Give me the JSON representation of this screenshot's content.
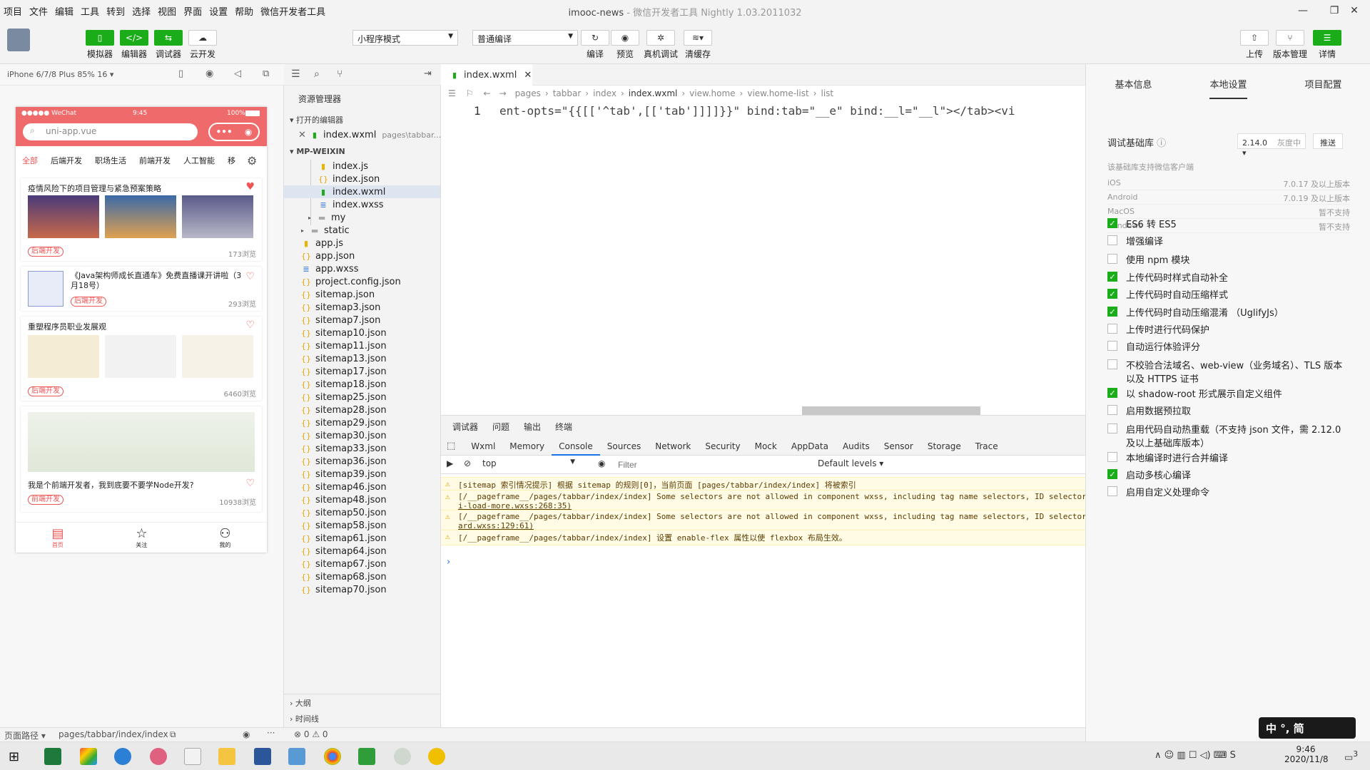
{
  "menubar": {
    "items": [
      "项目",
      "文件",
      "编辑",
      "工具",
      "转到",
      "选择",
      "视图",
      "界面",
      "设置",
      "帮助",
      "微信开发者工具"
    ],
    "title": "imooc-news",
    "title_sub": "- 微信开发者工具 Nightly 1.03.2011032"
  },
  "toolbar": {
    "simulator": "模拟器",
    "editor": "编辑器",
    "debugger": "调试器",
    "cloud": "云开发",
    "mode_select": "小程序模式",
    "compile_select": "普通编译",
    "compile": "编译",
    "preview": "预览",
    "realdebug": "真机调试",
    "clearcache": "清缓存",
    "upload": "上传",
    "version": "版本管理",
    "details": "详情"
  },
  "simulator": {
    "device": "iPhone 6/7/8 Plus 85% 16",
    "statusbar": {
      "carrier": "●●●●● WeChat",
      "time": "9:45",
      "battery": "100%"
    },
    "search_placeholder": "uni-app.vue",
    "tabs": [
      "全部",
      "后端开发",
      "职场生活",
      "前端开发",
      "人工智能",
      "移"
    ],
    "cards": [
      {
        "title": "疫情风险下的项目管理与紧急预案策略",
        "tag": "后端开发",
        "views": "173浏览"
      },
      {
        "title": "《Java架构师成长直通车》免费直播课开讲啦（3月18号）",
        "tag": "后端开发",
        "views": "293浏览"
      },
      {
        "title": "重塑程序员职业发展观",
        "tag": "后端开发",
        "views": "6460浏览"
      },
      {
        "title": "我是个前端开发者，我到底要不要学Node开发?",
        "tag": "前端开发",
        "views": "10938浏览"
      }
    ],
    "bottom_nav": [
      "首页",
      "关注",
      "我的"
    ],
    "path_label": "页面路径",
    "path": "pages/tabbar/index/index"
  },
  "explorer": {
    "title": "资源管理器",
    "open_editors": "打开的编辑器",
    "open_file": "index.wxml",
    "open_file_path": "pages\\tabbar...",
    "project": "MP-WEIXIN",
    "files": [
      {
        "name": "index.js",
        "type": "js",
        "indent": 3
      },
      {
        "name": "index.json",
        "type": "json",
        "indent": 3
      },
      {
        "name": "index.wxml",
        "type": "wxml",
        "indent": 3
      },
      {
        "name": "index.wxss",
        "type": "wxss",
        "indent": 3
      },
      {
        "name": "my",
        "type": "folder",
        "indent": 2
      },
      {
        "name": "static",
        "type": "folder",
        "indent": 1
      },
      {
        "name": "app.js",
        "type": "js",
        "indent": 1
      },
      {
        "name": "app.json",
        "type": "json",
        "indent": 1
      },
      {
        "name": "app.wxss",
        "type": "wxss",
        "indent": 1
      },
      {
        "name": "project.config.json",
        "type": "json",
        "indent": 1
      },
      {
        "name": "sitemap.json",
        "type": "json",
        "indent": 1
      },
      {
        "name": "sitemap3.json",
        "type": "json",
        "indent": 1
      },
      {
        "name": "sitemap7.json",
        "type": "json",
        "indent": 1
      },
      {
        "name": "sitemap10.json",
        "type": "json",
        "indent": 1
      },
      {
        "name": "sitemap11.json",
        "type": "json",
        "indent": 1
      },
      {
        "name": "sitemap13.json",
        "type": "json",
        "indent": 1
      },
      {
        "name": "sitemap17.json",
        "type": "json",
        "indent": 1
      },
      {
        "name": "sitemap18.json",
        "type": "json",
        "indent": 1
      },
      {
        "name": "sitemap25.json",
        "type": "json",
        "indent": 1
      },
      {
        "name": "sitemap28.json",
        "type": "json",
        "indent": 1
      },
      {
        "name": "sitemap29.json",
        "type": "json",
        "indent": 1
      },
      {
        "name": "sitemap30.json",
        "type": "json",
        "indent": 1
      },
      {
        "name": "sitemap33.json",
        "type": "json",
        "indent": 1
      },
      {
        "name": "sitemap36.json",
        "type": "json",
        "indent": 1
      },
      {
        "name": "sitemap39.json",
        "type": "json",
        "indent": 1
      },
      {
        "name": "sitemap46.json",
        "type": "json",
        "indent": 1
      },
      {
        "name": "sitemap48.json",
        "type": "json",
        "indent": 1
      },
      {
        "name": "sitemap50.json",
        "type": "json",
        "indent": 1
      },
      {
        "name": "sitemap58.json",
        "type": "json",
        "indent": 1
      },
      {
        "name": "sitemap61.json",
        "type": "json",
        "indent": 1
      },
      {
        "name": "sitemap64.json",
        "type": "json",
        "indent": 1
      },
      {
        "name": "sitemap67.json",
        "type": "json",
        "indent": 1
      },
      {
        "name": "sitemap68.json",
        "type": "json",
        "indent": 1
      },
      {
        "name": "sitemap70.json",
        "type": "json",
        "indent": 1
      }
    ],
    "outline": "大纲",
    "timeline": "时间线"
  },
  "editor": {
    "tab": "index.wxml",
    "breadcrumb": [
      "pages",
      "tabbar",
      "index",
      "index.wxml",
      "view.home",
      "view.home-list",
      "list"
    ],
    "line_number": "1",
    "code": "ent-opts=\"{{[['^tab',[['tab']]]]}}\" bind:tab=\"__e\" bind:__l=\"__l\"></tab><vi"
  },
  "devtools": {
    "top_tabs": [
      "调试器",
      "问题",
      "输出",
      "终端"
    ],
    "tabs": [
      "Wxml",
      "Memory",
      "Console",
      "Sources",
      "Network",
      "Security",
      "Mock",
      "AppData",
      "Audits",
      "Sensor",
      "Storage",
      "Trace"
    ],
    "context": "top",
    "filter_placeholder": "Filter",
    "levels": "Default levels",
    "logs": [
      {
        "text": "[sitemap 索引情况提示] 根据 sitemap 的规则[0]，当前页面 [pages/tabbar/index/index] 将被索引",
        "link": ""
      },
      {
        "text": "[/__pageframe__/pages/tabbar/index/index] Some selectors are not allowed in component wxss, including tag name selectors, ID selector",
        "link": "i-load-more.wxss:268:35)"
      },
      {
        "text": "[/__pageframe__/pages/tabbar/index/index] Some selectors are not allowed in component wxss, including tag name selectors, ID selector",
        "link": "ard.wxss:129:61)"
      },
      {
        "text": "[/__pageframe__/pages/tabbar/index/index] 设置 enable-flex 属性以使 flexbox 布局生效。",
        "link": ""
      }
    ],
    "prompt": "›"
  },
  "statusbar": {
    "errors": "0",
    "warnings": "0"
  },
  "rpanel": {
    "tabs": [
      "基本信息",
      "本地设置",
      "项目配置"
    ],
    "lib_label": "调试基础库",
    "lib_version": "2.14.0",
    "lib_gray": "灰度中",
    "push": "推送",
    "support_title": "该基础库支持微信客户端",
    "support": [
      {
        "os": "iOS",
        "ver": "7.0.17 及以上版本"
      },
      {
        "os": "Android",
        "ver": "7.0.19 及以上版本"
      },
      {
        "os": "MacOS",
        "ver": "暂不支持"
      },
      {
        "os": "Windows",
        "ver": "暂不支持"
      }
    ],
    "options": [
      {
        "label": "ES6 转 ES5",
        "on": true
      },
      {
        "label": "增强编译",
        "on": false
      },
      {
        "label": "使用 npm 模块",
        "on": false
      },
      {
        "label": "上传代码时样式自动补全",
        "on": true
      },
      {
        "label": "上传代码时自动压缩样式",
        "on": true
      },
      {
        "label": "上传代码时自动压缩混淆 （UglifyJs）",
        "on": true
      },
      {
        "label": "上传时进行代码保护",
        "on": false
      },
      {
        "label": "自动运行体验评分",
        "on": false
      },
      {
        "label": "不校验合法域名、web-view（业务域名）、TLS 版本以及 HTTPS 证书",
        "on": false
      },
      {
        "label": "以 shadow-root 形式展示自定义组件",
        "on": true
      },
      {
        "label": "启用数据预拉取",
        "on": false
      },
      {
        "label": "启用代码自动热重载（不支持 json 文件，需 2.12.0 及以上基础库版本）",
        "on": false
      },
      {
        "label": "本地编译时进行合并编译",
        "on": false
      },
      {
        "label": "启动多核心编译",
        "on": true
      },
      {
        "label": "启用自定义处理命令",
        "on": false
      }
    ]
  },
  "taskbar": {
    "time": "9:46",
    "date": "2020/11/8",
    "notif": "3",
    "ime": "中 °, 简"
  },
  "colors": {
    "accent": "#1aad19",
    "phone_header": "#ef6a6a",
    "warning_bg": "#fffbe5"
  }
}
